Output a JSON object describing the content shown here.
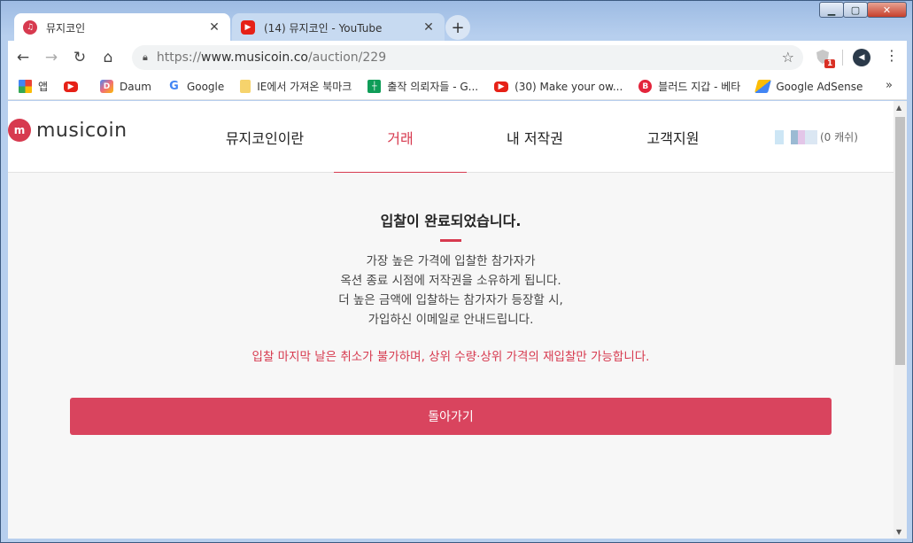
{
  "browser": {
    "tabs": [
      {
        "title": "뮤지코인",
        "favicon": "musicoin-favicon-icon",
        "active": true
      },
      {
        "title": "(14) 뮤지코인 - YouTube",
        "favicon": "youtube-favicon-icon",
        "active": false
      }
    ],
    "new_tab_label": "+",
    "close_tab_glyph": "✕",
    "url": {
      "scheme": "https://",
      "host": "www.musicoin.co",
      "path": "/auction/229"
    },
    "extension_badge": "1",
    "bookmarks": [
      {
        "label": "앱",
        "icon": "apps-grid-icon"
      },
      {
        "label": "",
        "icon": "youtube-icon"
      },
      {
        "label": "Daum",
        "icon": "daum-icon"
      },
      {
        "label": "Google",
        "icon": "google-icon"
      },
      {
        "label": "IE에서 가져온 북마크",
        "icon": "folder-icon"
      },
      {
        "label": "출작 의뢰자들 - G...",
        "icon": "sheets-icon"
      },
      {
        "label": "(30) Make your ow...",
        "icon": "youtube-icon"
      },
      {
        "label": "블러드 지갑 - 베타",
        "icon": "bitcoin-icon"
      },
      {
        "label": "Google AdSense",
        "icon": "adsense-icon"
      }
    ],
    "bookmarks_more": "»"
  },
  "site": {
    "logo_text": "musicoin",
    "nav": [
      "뮤지코인이란",
      "거래",
      "내 저작권",
      "고객지원"
    ],
    "active_nav": "거래",
    "user_balance": "(0 캐쉬)"
  },
  "main": {
    "headline": "입찰이 완료되었습니다.",
    "description": [
      "가장 높은 가격에 입찰한 참가자가",
      "옥션 종료 시점에 저작권을 소유하게 됩니다.",
      "더 높은 금액에 입찰하는 참가자가 등장할 시,",
      "가입하신 이메일로 안내드립니다."
    ],
    "warning": "입찰 마지막 날은 취소가 불가하며, 상위 수량·상위 가격의 재입찰만 가능합니다.",
    "back_button": "돌아가기"
  },
  "colors": {
    "accent": "#d73a4f",
    "button": "#d9445e",
    "content_bg": "#f7f7f7"
  }
}
